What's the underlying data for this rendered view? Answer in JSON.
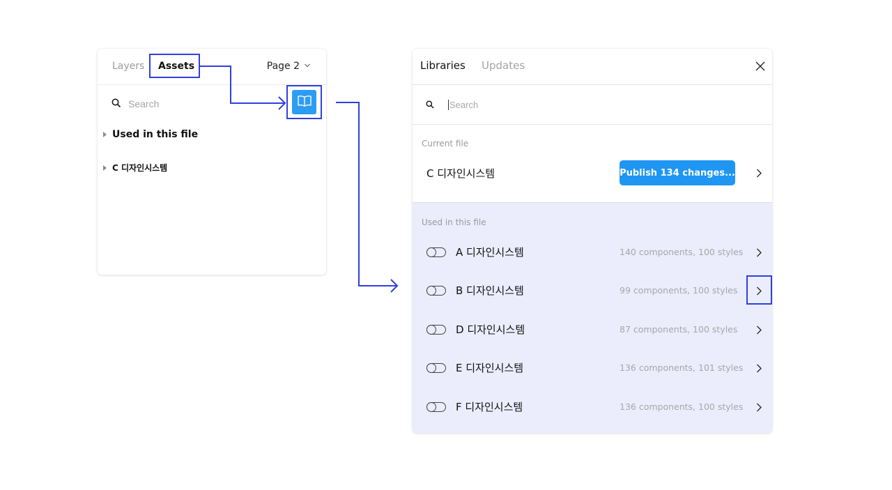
{
  "assets_panel": {
    "tabs": [
      "Layers",
      "Assets"
    ],
    "page_label": "Page 2",
    "search_placeholder": "Search",
    "sections": [
      "Used in this file",
      "C 디자인시스템"
    ]
  },
  "libraries_panel": {
    "tabs": [
      "Libraries",
      "Updates"
    ],
    "search_placeholder": "Search",
    "current_file": {
      "label": "Current file",
      "name": "C 디자인시스템",
      "publish_label": "Publish 134 changes..."
    },
    "used_in_file": {
      "label": "Used in this file",
      "libraries": [
        {
          "name": "A 디자인시스템",
          "meta": "140 components, 100 styles"
        },
        {
          "name": "B 디자인시스템",
          "meta": "99 components, 100 styles"
        },
        {
          "name": "D 디자인시스템",
          "meta": "87 components, 100 styles"
        },
        {
          "name": "E 디자인시스템",
          "meta": "136 components, 101 styles"
        },
        {
          "name": "F 디자인시스템",
          "meta": "136 components, 100 styles"
        }
      ]
    }
  },
  "colors": {
    "accent": "#2f3fe0",
    "button_blue": "#1e96f2",
    "used_bg": "#ebedfc"
  }
}
